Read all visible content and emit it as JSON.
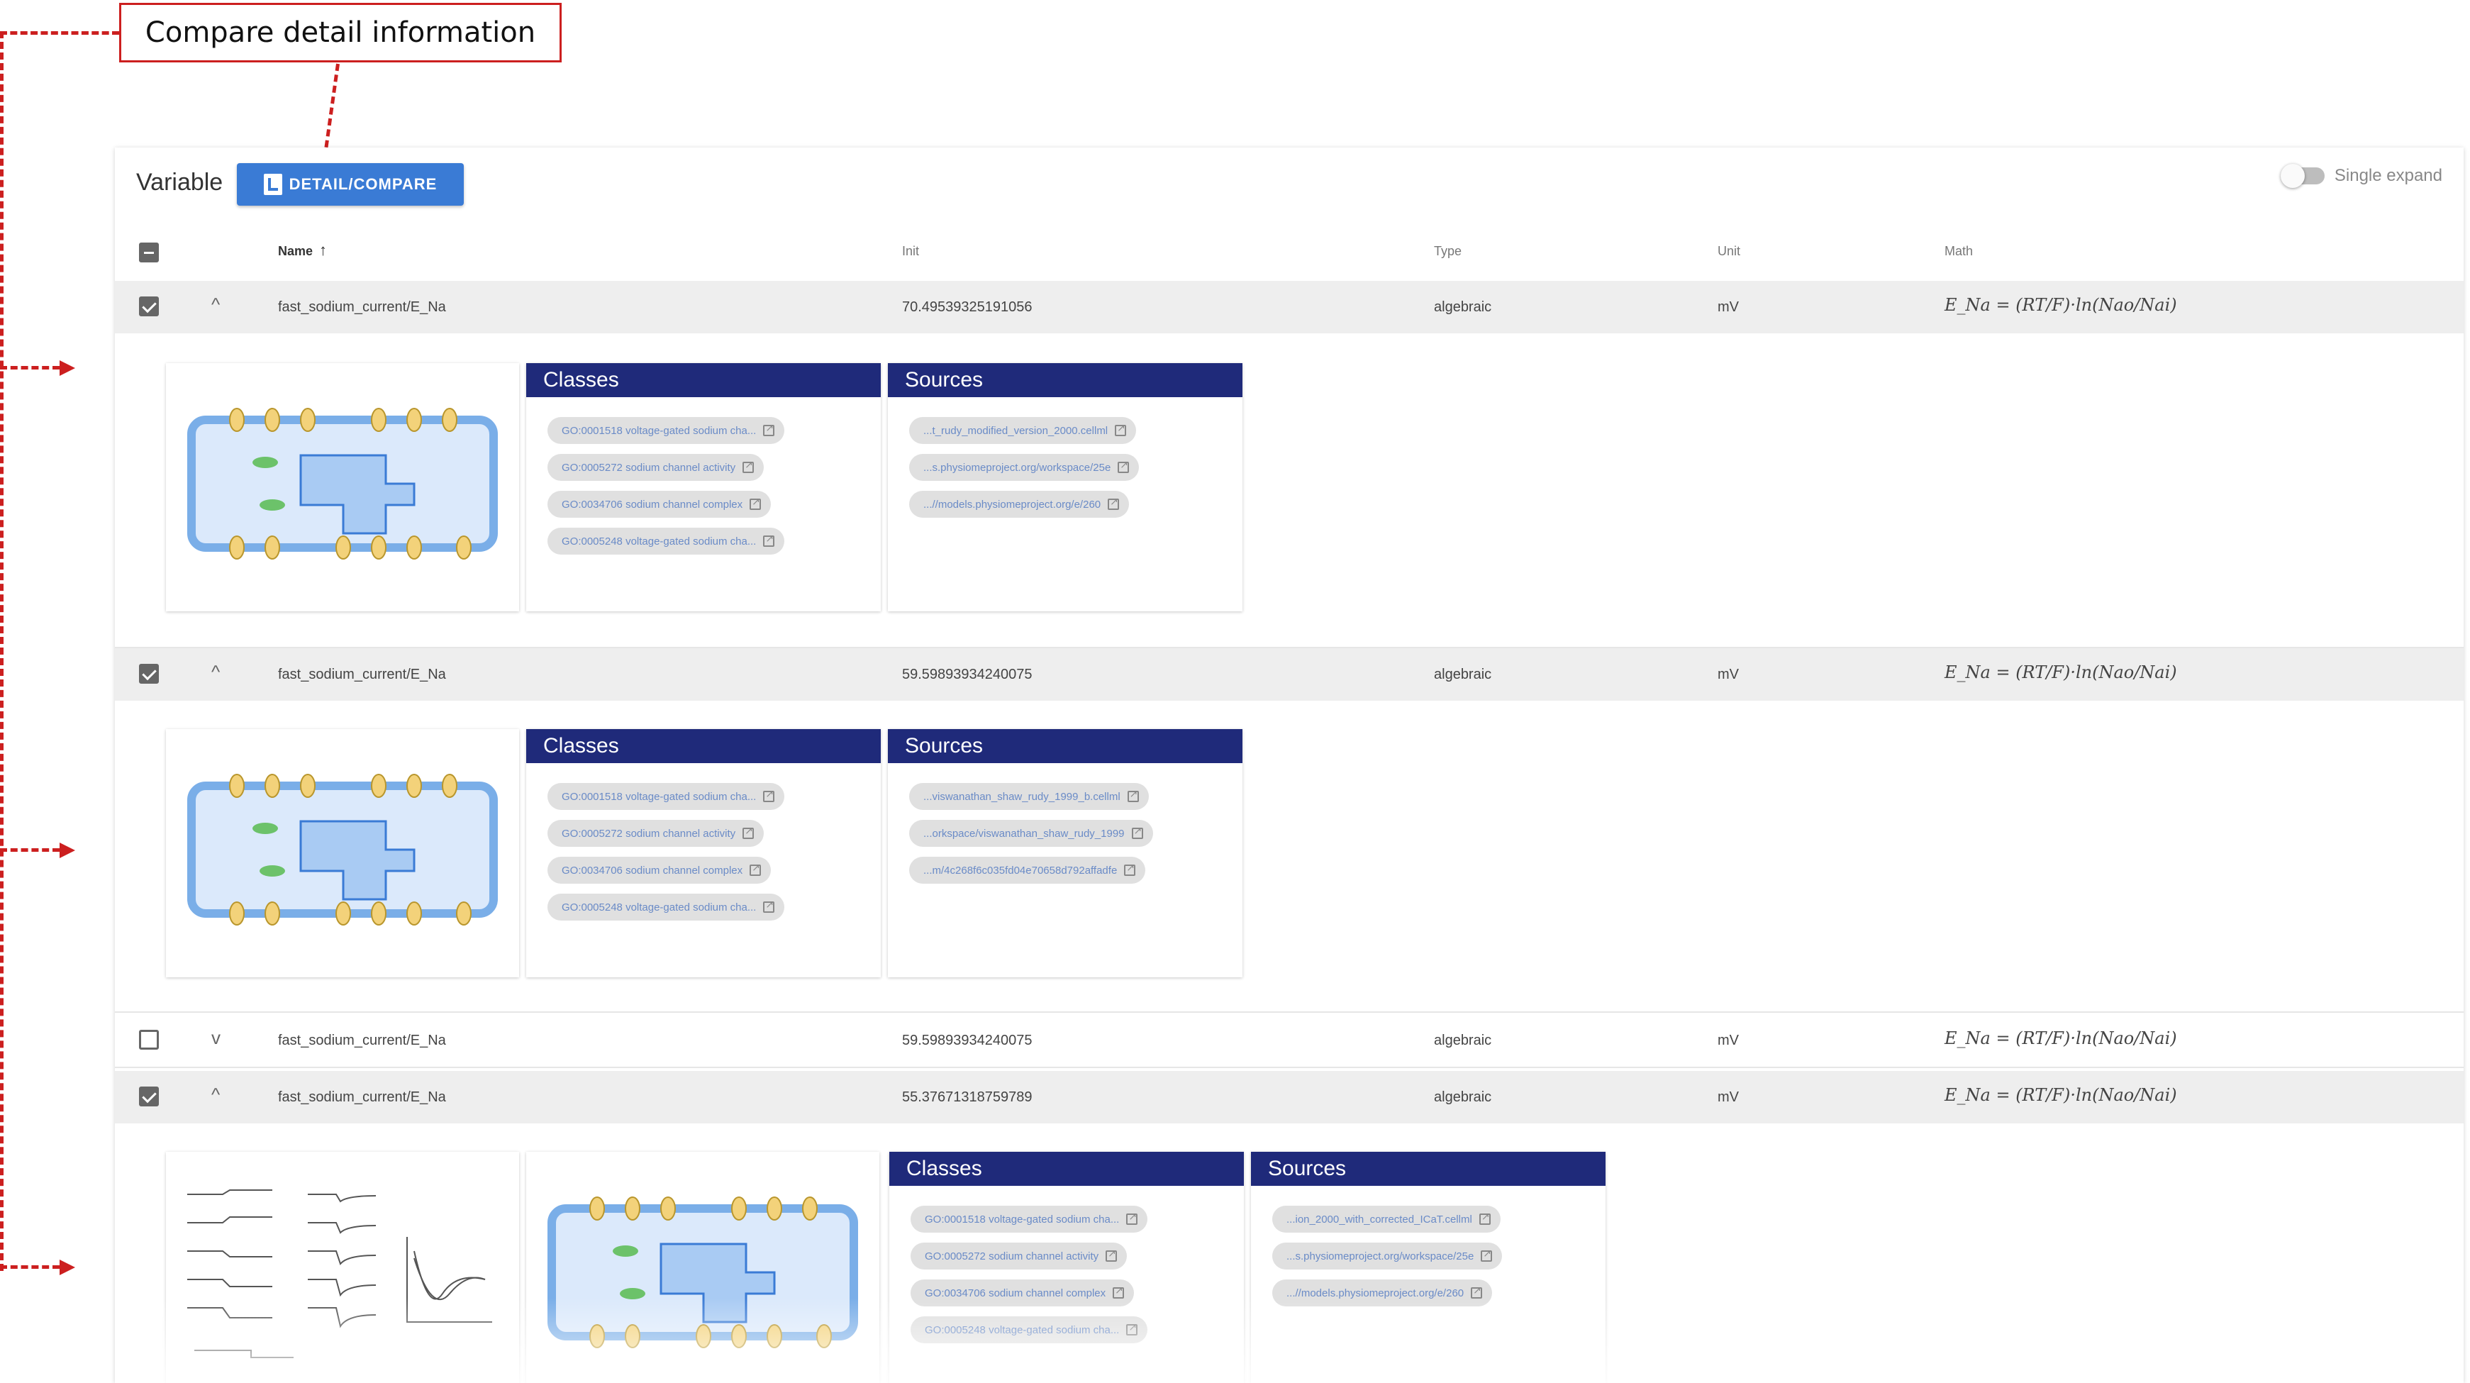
{
  "annotation": {
    "label": "Compare detail information"
  },
  "toolbar": {
    "title": "Variable",
    "detail_button_label": "DETAIL/COMPARE",
    "single_expand_label": "Single expand"
  },
  "table": {
    "columns": {
      "name": "Name",
      "init": "Init",
      "type": "Type",
      "unit": "Unit",
      "math": "Math"
    },
    "sort_indicator": "↑",
    "rows": [
      {
        "name": "fast_sodium_current/E_Na",
        "init": "70.495393251910​56",
        "type": "algebraic",
        "unit": "mV",
        "math": "E_Na = (RT/F)·ln(Nao/Nai)",
        "chevron": "^"
      },
      {
        "name": "fast_sodium_current/E_Na",
        "init": "59.598939342400​75",
        "type": "algebraic",
        "unit": "mV",
        "math": "E_Na = (RT/F)·ln(Nao/Nai)",
        "chevron": "^"
      },
      {
        "name": "fast_sodium_current/E_Na",
        "init": "59.598939342400​75",
        "type": "algebraic",
        "unit": "mV",
        "math": "E_Na = (RT/F)·ln(Nao/Nai)",
        "chevron": "v"
      },
      {
        "name": "fast_sodium_current/E_Na",
        "init": "55.376713187597​89",
        "type": "algebraic",
        "unit": "mV",
        "math": "E_Na = (RT/F)·ln(Nao/Nai)",
        "chevron": "^"
      }
    ]
  },
  "cards": {
    "classes_title": "Classes",
    "sources_title": "Sources",
    "classes": [
      "GO:0001518 voltage-gated sodium cha...",
      "GO:0005272 sodium channel activity",
      "GO:0034706 sodium channel complex",
      "GO:0005248 voltage-gated sodium cha..."
    ],
    "details": [
      {
        "sources": [
          "...t_rudy_modified_version_2000.cellml",
          "...s.physiomeproject.org/workspace/25e",
          "...//models.physiomeproject.org/e/260"
        ]
      },
      {
        "sources": [
          "...viswanathan_shaw_rudy_1999_b.cellml",
          "...orkspace/viswanathan_shaw_rudy_1999",
          "...m/4c268f6c035fd04e70658d792affadfe"
        ]
      },
      {
        "sources": [
          "...ion_2000_with_corrected_ICaT.cellml",
          "...s.physiomeproject.org/workspace/25e",
          "...//models.physiomeproject.org/e/260"
        ]
      }
    ]
  },
  "colors": {
    "accent": "#3a7bd5",
    "card_header": "#1f2a7a",
    "annotation": "#cc1f1f"
  }
}
